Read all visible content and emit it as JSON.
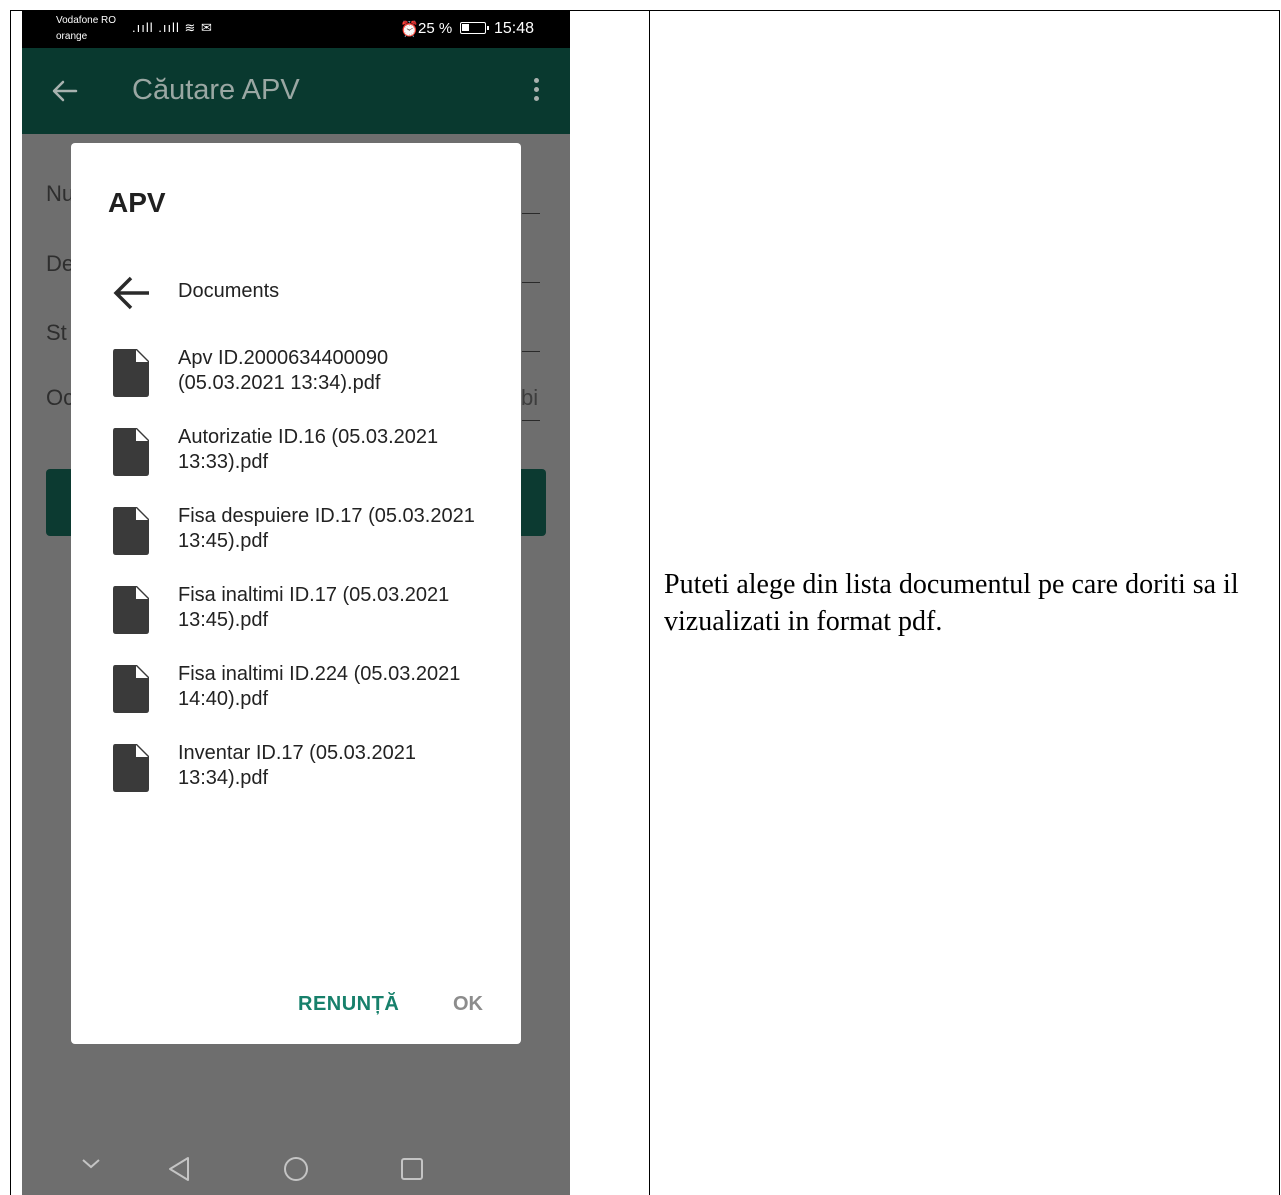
{
  "status_bar": {
    "carrier_line1": "Vodafone RO",
    "carrier_line2": "orange",
    "signal_icons": ".ııll  .ııll ≋ ✉",
    "battery": "25 %",
    "time": "15:48"
  },
  "app_bar": {
    "title": "Căutare APV"
  },
  "background_form": {
    "labels": [
      "Nu",
      "De",
      "St",
      "Oc"
    ],
    "partial_value": "bi"
  },
  "dialog": {
    "title": "APV",
    "folder": "Documents",
    "files": [
      {
        "name": "Apv ID.2000634400090 (05.03.2021 13:34).pdf"
      },
      {
        "name": "Autorizatie ID.16 (05.03.2021 13:33).pdf"
      },
      {
        "name": "Fisa despuiere ID.17 (05.03.2021 13:45).pdf"
      },
      {
        "name": "Fisa inaltimi ID.17 (05.03.2021 13:45).pdf"
      },
      {
        "name": "Fisa inaltimi ID.224 (05.03.2021 14:40).pdf"
      },
      {
        "name": "Inventar ID.17 (05.03.2021 13:34).pdf"
      }
    ],
    "cancel_label": "RENUNȚĂ",
    "ok_label": "OK"
  },
  "caption": "Puteti alege din lista documentul pe care doriti sa il vizualizati in format pdf.",
  "colors": {
    "app_bar": "#09392f",
    "accent": "#17806b",
    "scrim": "#6e6e6e"
  }
}
